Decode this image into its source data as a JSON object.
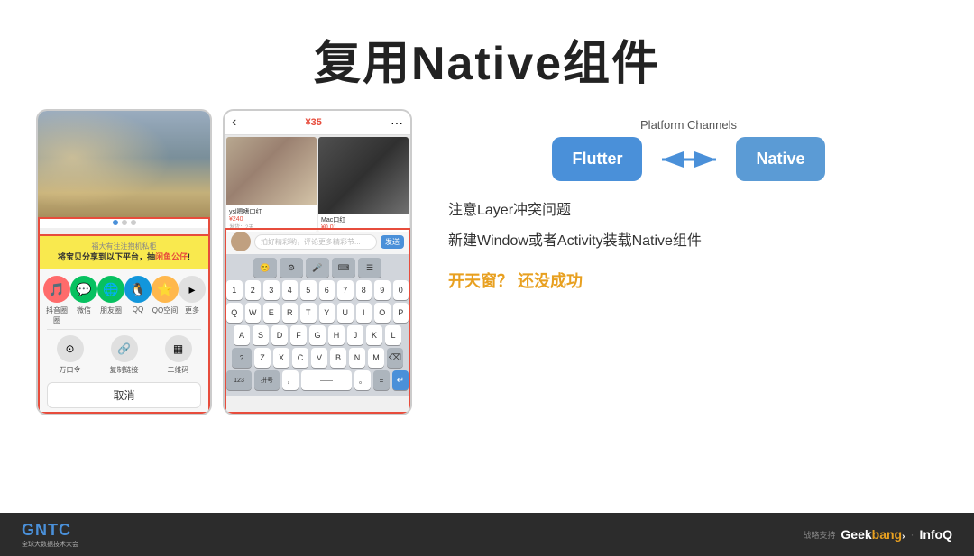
{
  "title": "复用Native组件",
  "platform": {
    "label": "Platform Channels",
    "flutter_label": "Flutter",
    "native_label": "Native",
    "arrow": "↔"
  },
  "notes": {
    "line1": "注意Layer冲突问题",
    "line2": "新建Window或者Activity装载Native组件",
    "highlight": "开天窗？  还没成功"
  },
  "phone1": {
    "share_header_line1": "福大有注注抱机私柜",
    "share_header_line2": "将宝贝分享到以下平台，抽",
    "share_header_highlight": "闲鱼公仔",
    "share_header_suffix": "!",
    "icons": [
      {
        "label": "抖音圈圈",
        "color": "#ff6b6b"
      },
      {
        "label": "微信",
        "color": "#07c160"
      },
      {
        "label": "朋友圈",
        "color": "#07c160"
      },
      {
        "label": "QQ",
        "color": "#1296db"
      },
      {
        "label": "QQ空间",
        "color": "#ffb84d"
      }
    ],
    "icons2": [
      {
        "label": "万口令",
        "color": "#aaa"
      },
      {
        "label": "复制链接",
        "color": "#aaa"
      },
      {
        "label": "二维码",
        "color": "#aaa"
      }
    ],
    "more_icon": "更多",
    "cancel_label": "取消"
  },
  "phone2": {
    "nav_back": "‹",
    "nav_price": "¥35",
    "product1_name": "ysl嗯嗜口红",
    "product1_price": "¥240",
    "product1_sub": "发货：2天",
    "product2_name": "Mac口红",
    "product2_price": "¥0 01",
    "comment_placeholder": "拍好精彩哟，评论更多精彩节...",
    "send_label": "发送",
    "keyboard_rows": [
      [
        "😊",
        "⚙️",
        "🎤",
        "⌨️",
        "☰"
      ],
      [
        "1",
        "2",
        "3",
        "4",
        "5",
        "6",
        "7",
        "8",
        "9",
        "0"
      ],
      [
        "Q",
        "W",
        "E",
        "R",
        "T",
        "Y",
        "U",
        "I",
        "O",
        "P"
      ],
      [
        "A",
        "S",
        "D",
        "F",
        "G",
        "H",
        "J",
        "K",
        "L"
      ],
      [
        "?",
        "Z",
        "X",
        "C",
        "V",
        "B",
        "N",
        "M",
        "⌫"
      ],
      [
        "123",
        "拼号",
        ",",
        "—",
        "。",
        "=",
        "↵"
      ]
    ]
  },
  "footer": {
    "logo": "GNTC",
    "logo_sub": "全球大数据技术大会",
    "powered_by": "战略支持",
    "brand1": "Geek",
    "brand2": "bang",
    "brand3": "›",
    "brand4": "InfoQ"
  }
}
